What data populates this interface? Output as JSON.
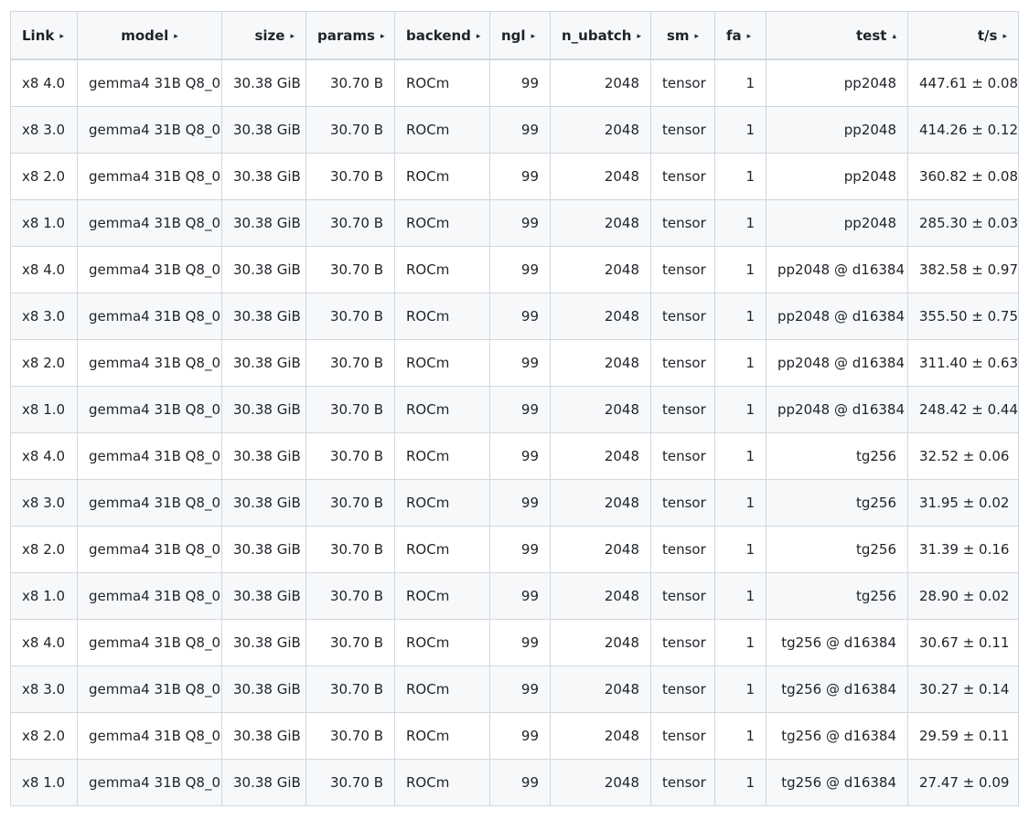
{
  "table": {
    "columns": [
      {
        "label": "Link",
        "sort_icon": "triangle-right-icon",
        "arrow": "▸"
      },
      {
        "label": "model",
        "sort_icon": "triangle-right-icon",
        "arrow": "▸"
      },
      {
        "label": "size",
        "sort_icon": "triangle-right-icon",
        "arrow": "▸"
      },
      {
        "label": "params",
        "sort_icon": "triangle-right-icon",
        "arrow": "▸"
      },
      {
        "label": "backend",
        "sort_icon": "triangle-right-icon",
        "arrow": "▸"
      },
      {
        "label": "ngl",
        "sort_icon": "triangle-right-icon",
        "arrow": "▸"
      },
      {
        "label": "n_ubatch",
        "sort_icon": "triangle-right-icon",
        "arrow": "▸"
      },
      {
        "label": "sm",
        "sort_icon": "triangle-right-icon",
        "arrow": "▸"
      },
      {
        "label": "fa",
        "sort_icon": "triangle-right-icon",
        "arrow": "▸"
      },
      {
        "label": "test",
        "sort_icon": "triangle-up-icon",
        "arrow": "▴"
      },
      {
        "label": "t/s",
        "sort_icon": "triangle-right-icon",
        "arrow": "▸"
      }
    ],
    "rows": [
      [
        "x8 4.0",
        "gemma4 31B Q8_0",
        "30.38 GiB",
        "30.70 B",
        "ROCm",
        "99",
        "2048",
        "tensor",
        "1",
        "pp2048",
        "447.61 ± 0.08"
      ],
      [
        "x8 3.0",
        "gemma4 31B Q8_0",
        "30.38 GiB",
        "30.70 B",
        "ROCm",
        "99",
        "2048",
        "tensor",
        "1",
        "pp2048",
        "414.26 ± 0.12"
      ],
      [
        "x8 2.0",
        "gemma4 31B Q8_0",
        "30.38 GiB",
        "30.70 B",
        "ROCm",
        "99",
        "2048",
        "tensor",
        "1",
        "pp2048",
        "360.82 ± 0.08"
      ],
      [
        "x8 1.0",
        "gemma4 31B Q8_0",
        "30.38 GiB",
        "30.70 B",
        "ROCm",
        "99",
        "2048",
        "tensor",
        "1",
        "pp2048",
        "285.30 ± 0.03"
      ],
      [
        "x8 4.0",
        "gemma4 31B Q8_0",
        "30.38 GiB",
        "30.70 B",
        "ROCm",
        "99",
        "2048",
        "tensor",
        "1",
        "pp2048 @ d16384",
        "382.58 ± 0.97"
      ],
      [
        "x8 3.0",
        "gemma4 31B Q8_0",
        "30.38 GiB",
        "30.70 B",
        "ROCm",
        "99",
        "2048",
        "tensor",
        "1",
        "pp2048 @ d16384",
        "355.50 ± 0.75"
      ],
      [
        "x8 2.0",
        "gemma4 31B Q8_0",
        "30.38 GiB",
        "30.70 B",
        "ROCm",
        "99",
        "2048",
        "tensor",
        "1",
        "pp2048 @ d16384",
        "311.40 ± 0.63"
      ],
      [
        "x8 1.0",
        "gemma4 31B Q8_0",
        "30.38 GiB",
        "30.70 B",
        "ROCm",
        "99",
        "2048",
        "tensor",
        "1",
        "pp2048 @ d16384",
        "248.42 ± 0.44"
      ],
      [
        "x8 4.0",
        "gemma4 31B Q8_0",
        "30.38 GiB",
        "30.70 B",
        "ROCm",
        "99",
        "2048",
        "tensor",
        "1",
        "tg256",
        "32.52 ± 0.06"
      ],
      [
        "x8 3.0",
        "gemma4 31B Q8_0",
        "30.38 GiB",
        "30.70 B",
        "ROCm",
        "99",
        "2048",
        "tensor",
        "1",
        "tg256",
        "31.95 ± 0.02"
      ],
      [
        "x8 2.0",
        "gemma4 31B Q8_0",
        "30.38 GiB",
        "30.70 B",
        "ROCm",
        "99",
        "2048",
        "tensor",
        "1",
        "tg256",
        "31.39 ± 0.16"
      ],
      [
        "x8 1.0",
        "gemma4 31B Q8_0",
        "30.38 GiB",
        "30.70 B",
        "ROCm",
        "99",
        "2048",
        "tensor",
        "1",
        "tg256",
        "28.90 ± 0.02"
      ],
      [
        "x8 4.0",
        "gemma4 31B Q8_0",
        "30.38 GiB",
        "30.70 B",
        "ROCm",
        "99",
        "2048",
        "tensor",
        "1",
        "tg256 @ d16384",
        "30.67 ± 0.11"
      ],
      [
        "x8 3.0",
        "gemma4 31B Q8_0",
        "30.38 GiB",
        "30.70 B",
        "ROCm",
        "99",
        "2048",
        "tensor",
        "1",
        "tg256 @ d16384",
        "30.27 ± 0.14"
      ],
      [
        "x8 2.0",
        "gemma4 31B Q8_0",
        "30.38 GiB",
        "30.70 B",
        "ROCm",
        "99",
        "2048",
        "tensor",
        "1",
        "tg256 @ d16384",
        "29.59 ± 0.11"
      ],
      [
        "x8 1.0",
        "gemma4 31B Q8_0",
        "30.38 GiB",
        "30.70 B",
        "ROCm",
        "99",
        "2048",
        "tensor",
        "1",
        "tg256 @ d16384",
        "27.47 ± 0.09"
      ]
    ]
  },
  "colors": {
    "border": "#d0d7de",
    "stripe": "#f6f8fa",
    "text": "#1f2328"
  }
}
